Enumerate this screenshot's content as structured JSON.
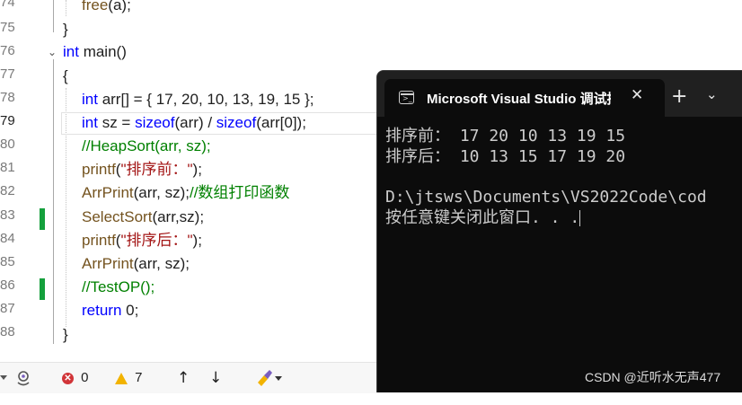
{
  "editor": {
    "line_numbers": [
      "74",
      "75",
      "76",
      "77",
      "78",
      "79",
      "80",
      "81",
      "82",
      "83",
      "84",
      "85",
      "86",
      "87",
      "88"
    ],
    "code": {
      "l74_fn": "free",
      "l74_rest": "(a);",
      "l75": "}",
      "l76_kw": "int",
      "l76_rest": " main()",
      "l77": "{",
      "l78_kw": "int",
      "l78_rest": " arr[] = { 17, 20, 10, 13, 19, 15 };",
      "l79_kw": "int",
      "l79_mid": " sz = ",
      "l79_kw2": "sizeof",
      "l79_mid2": "(arr) / ",
      "l79_kw3": "sizeof",
      "l79_rest": "(arr[0]);",
      "l80_comment": "//HeapSort(arr, sz);",
      "l81_fn": "printf",
      "l81_open": "(",
      "l81_str": "\"排序前：\"",
      "l81_close": ");",
      "l82_fn": "ArrPrint",
      "l82_rest": "(arr, sz);",
      "l82_comment": "//数组打印函数",
      "l83_fn": "SelectSort",
      "l83_rest": "(arr,sz);",
      "l84_fn": "printf",
      "l84_open": "(",
      "l84_str": "\"排序后：\"",
      "l84_close": ");",
      "l85_fn": "ArrPrint",
      "l85_rest": "(arr, sz);",
      "l86_comment": "//TestOP();",
      "l87_kw": "return",
      "l87_rest": " 0;",
      "l88": "}"
    },
    "current_line": "79"
  },
  "statusbar": {
    "errors_count": "0",
    "warnings_count": "7",
    "error_symbol": "✕",
    "up_arrow": "↑",
    "down_arrow": "↓",
    "icons": [
      "copilot-icon",
      "error-icon",
      "warning-icon",
      "arrow-up-icon",
      "arrow-down-icon",
      "code-cleanup-icon"
    ]
  },
  "terminal": {
    "tab_title": "Microsoft Visual Studio 调试控制台",
    "close_symbol": "✕",
    "new_tab_symbol": "+",
    "dropdown_symbol": "⌄",
    "prompt_symbol": ">_",
    "lines": [
      "排序前： 17 20 10 13 19 15",
      "排序后： 10 13 15 17 19 20",
      "",
      "D:\\jtsws\\Documents\\VS2022Code\\cod",
      "按任意键关闭此窗口. . ."
    ]
  },
  "watermark": "CSDN @近听水无声477",
  "colors": {
    "keyword": "#0000ff",
    "string": "#a31515",
    "comment": "#008000",
    "function": "#74531f",
    "change_mark": "#14a03c",
    "terminal_bg": "#0c0c0c",
    "terminal_text": "#cccccc"
  }
}
